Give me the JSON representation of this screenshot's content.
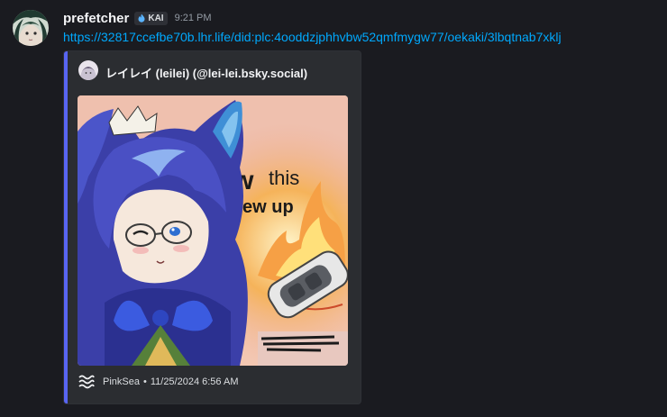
{
  "message": {
    "username": "prefetcher",
    "tag": "KAI",
    "timestamp": "9:21 PM",
    "link": "https://32817ccefbe70b.lhr.life/did:plc:4ooddzjphhvbw52qmfmygw77/oekaki/3lbqtnab7xklj"
  },
  "embed": {
    "author": "レイレイ (leilei) (@lei-lei.bsky.social)",
    "image_text": {
      "line1_a": "Wow",
      "line1_b": "this",
      "line2": "Blew up"
    },
    "footer": {
      "provider": "PinkSea",
      "separator": "•",
      "date": "11/25/2024 6:56 AM"
    },
    "accent_color": "#5865f2"
  },
  "colors": {
    "background": "#1a1b20",
    "link": "#00a8fc",
    "username": "#f2f3f5",
    "timestamp": "#949ba4"
  },
  "icons": {
    "tag_icon": "flame-icon",
    "footer_icon": "waves-icon"
  }
}
